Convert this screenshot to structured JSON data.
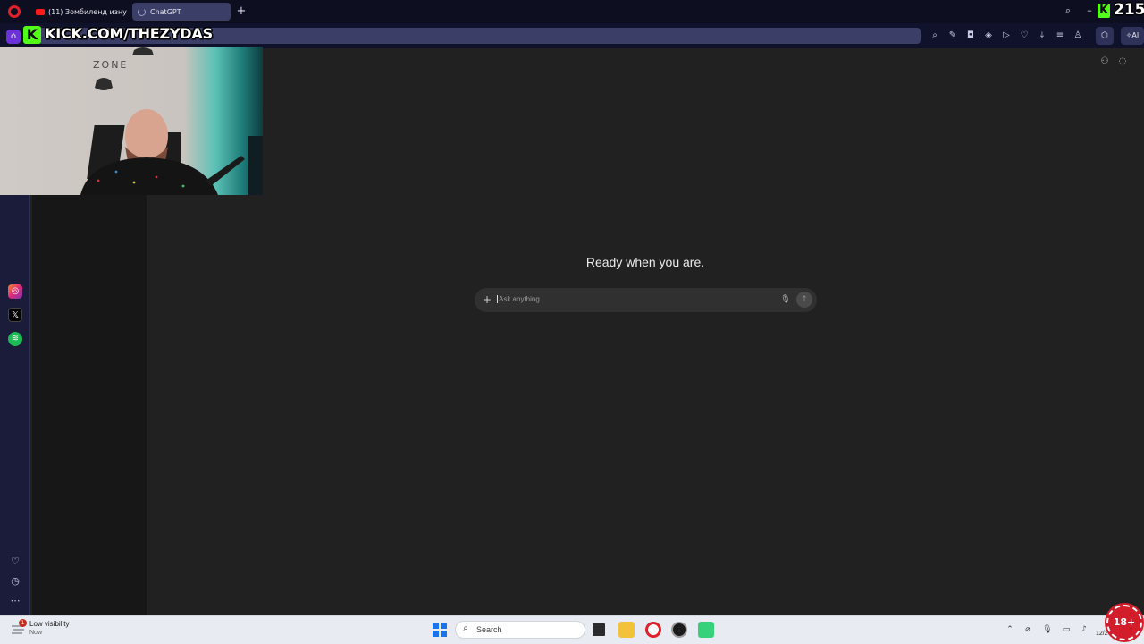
{
  "browser": {
    "tabs": [
      {
        "label": "(11) Зомбиленд изнутри",
        "icon": "youtube-icon"
      },
      {
        "label": "ChatGPT",
        "icon": "loading-spinner-icon"
      }
    ],
    "new_tab_label": "+",
    "ai_button_label": "AI"
  },
  "overlay": {
    "kick_logo": "K",
    "kick_url": "KICK.COM/THEZYDAS",
    "viewer_count": "215"
  },
  "chatgpt": {
    "hero_text": "Ready when you are.",
    "composer_placeholder": "Ask anything"
  },
  "taskbar": {
    "weather_title": "Low visibility",
    "weather_subtitle": "Now",
    "notification_count": "1",
    "search_label": "Search",
    "clock": "12/2",
    "age_badge": "18+"
  },
  "colors": {
    "opera_red": "#e0202a",
    "tab_active": "#3b3e66",
    "kick_green": "#53fc18",
    "chat_bg": "#212121",
    "composer_bg": "#303030"
  }
}
